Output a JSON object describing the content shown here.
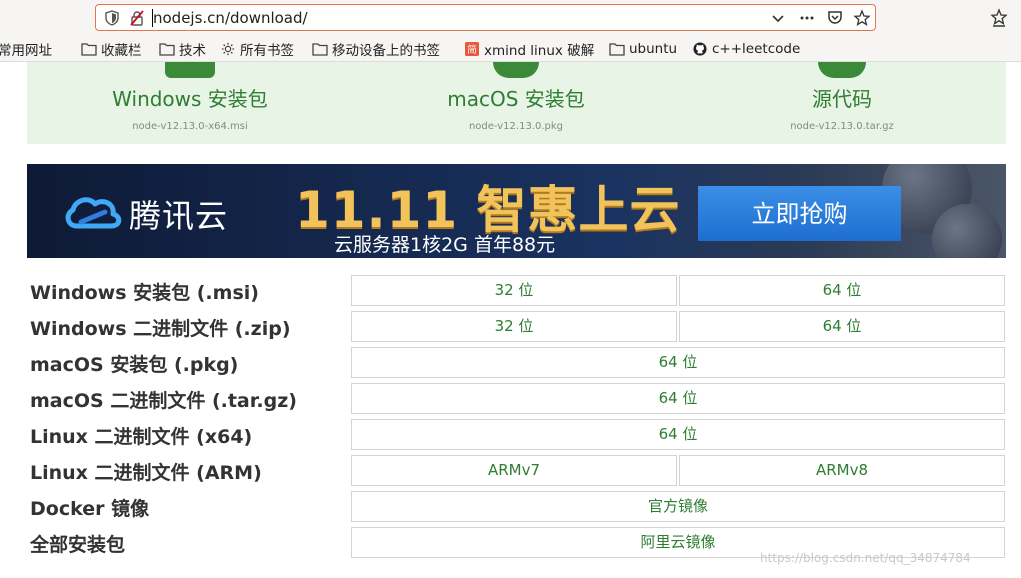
{
  "browser": {
    "url": "nodejs.cn/download/",
    "bookmarks": [
      {
        "label": "常用网址",
        "icon": "folder-icon"
      },
      {
        "label": "收藏栏",
        "icon": "folder-icon"
      },
      {
        "label": "技术",
        "icon": "folder-icon"
      },
      {
        "label": "所有书签",
        "icon": "gear-icon"
      },
      {
        "label": "移动设备上的书签",
        "icon": "folder-icon"
      },
      {
        "label": "xmind linux 破解",
        "icon": "jianshu-icon"
      },
      {
        "label": "ubuntu",
        "icon": "folder-icon"
      },
      {
        "label": "c++leetcode",
        "icon": "github-icon"
      }
    ]
  },
  "downloads": [
    {
      "title": "Windows 安装包",
      "file": "node-v12.13.0-x64.msi"
    },
    {
      "title": "macOS 安装包",
      "file": "node-v12.13.0.pkg"
    },
    {
      "title": "源代码",
      "file": "node-v12.13.0.tar.gz"
    }
  ],
  "banner": {
    "brand": "腾讯云",
    "headline": "11.11 智惠上云",
    "sub": "云服务器1核2G 首年88元",
    "cta": "立即抢购"
  },
  "table": [
    {
      "label": "Windows 安装包 (.msi)",
      "cells": [
        "32 位",
        "64 位"
      ]
    },
    {
      "label": "Windows 二进制文件 (.zip)",
      "cells": [
        "32 位",
        "64 位"
      ]
    },
    {
      "label": "macOS 安装包 (.pkg)",
      "cells": [
        "64 位"
      ]
    },
    {
      "label": "macOS 二进制文件 (.tar.gz)",
      "cells": [
        "64 位"
      ]
    },
    {
      "label": "Linux 二进制文件 (x64)",
      "cells": [
        "64 位"
      ]
    },
    {
      "label": "Linux 二进制文件 (ARM)",
      "cells": [
        "ARMv7",
        "ARMv8"
      ]
    },
    {
      "label": "Docker 镜像",
      "cells": [
        "官方镜像"
      ]
    },
    {
      "label": "全部安装包",
      "cells": [
        "阿里云镜像"
      ]
    }
  ],
  "watermark": "https://blog.csdn.net/qq_34874784"
}
